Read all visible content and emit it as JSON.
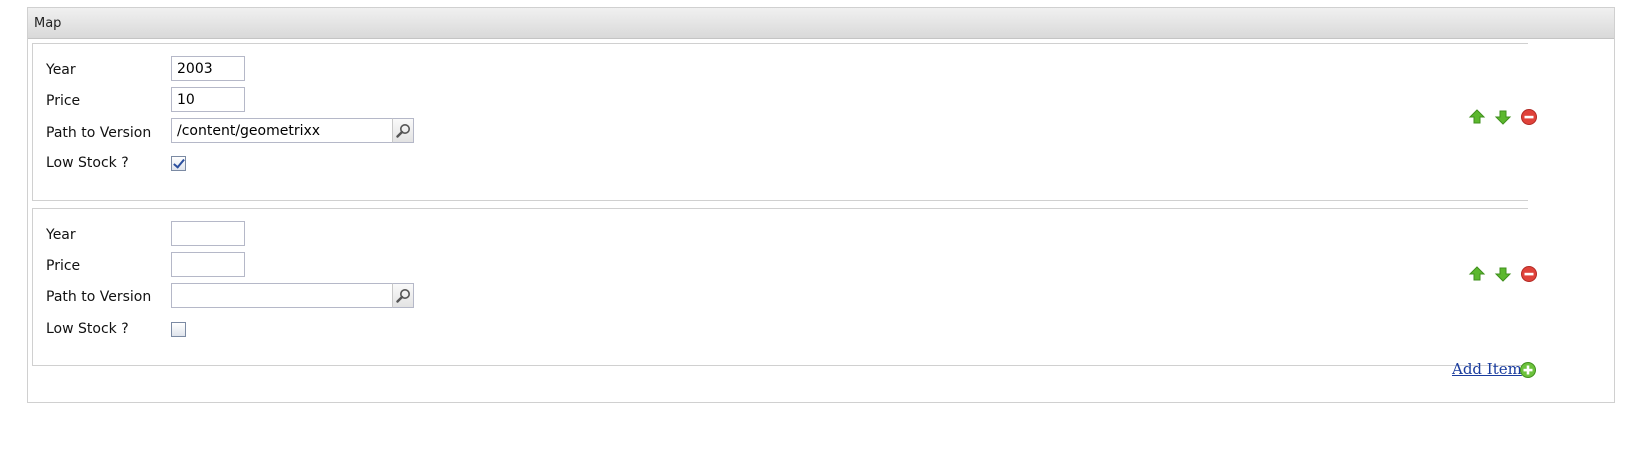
{
  "panel": {
    "title": "Map"
  },
  "items": [
    {
      "year_label": "Year",
      "year_value": "2003",
      "price_label": "Price",
      "price_value": "10",
      "path_label": "Path to Version",
      "path_value": "/content/geometrixx",
      "lowstock_label": "Low Stock ?",
      "lowstock_checked": true
    },
    {
      "year_label": "Year",
      "year_value": "",
      "price_label": "Price",
      "price_value": "",
      "path_label": "Path to Version",
      "path_value": "",
      "lowstock_label": "Low Stock ?",
      "lowstock_checked": false
    }
  ],
  "footer": {
    "add_item_label": "Add Item"
  },
  "icons": {
    "move_up": "arrow-up-icon",
    "move_down": "arrow-down-icon",
    "remove": "remove-icon",
    "add": "add-icon",
    "browse": "magnifier-icon"
  },
  "colors": {
    "arrow_green": "#5cb82e",
    "remove_red": "#e0423a",
    "link_blue": "#1a3c9e"
  }
}
